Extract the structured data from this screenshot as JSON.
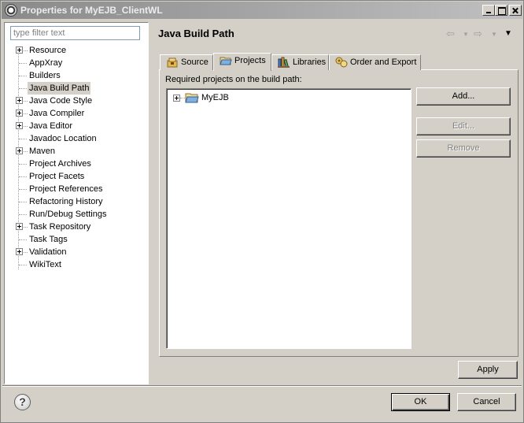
{
  "window": {
    "title": "Properties for MyEJB_ClientWL"
  },
  "filter": {
    "placeholder": "type filter text"
  },
  "tree": {
    "items": [
      {
        "label": "Resource",
        "expandable": true
      },
      {
        "label": "AppXray",
        "expandable": false
      },
      {
        "label": "Builders",
        "expandable": false
      },
      {
        "label": "Java Build Path",
        "expandable": false,
        "selected": true
      },
      {
        "label": "Java Code Style",
        "expandable": true
      },
      {
        "label": "Java Compiler",
        "expandable": true
      },
      {
        "label": "Java Editor",
        "expandable": true
      },
      {
        "label": "Javadoc Location",
        "expandable": false
      },
      {
        "label": "Maven",
        "expandable": true
      },
      {
        "label": "Project Archives",
        "expandable": false
      },
      {
        "label": "Project Facets",
        "expandable": false
      },
      {
        "label": "Project References",
        "expandable": false
      },
      {
        "label": "Refactoring History",
        "expandable": false
      },
      {
        "label": "Run/Debug Settings",
        "expandable": false
      },
      {
        "label": "Task Repository",
        "expandable": true
      },
      {
        "label": "Task Tags",
        "expandable": false
      },
      {
        "label": "Validation",
        "expandable": true
      },
      {
        "label": "WikiText",
        "expandable": false
      }
    ]
  },
  "page": {
    "title": "Java Build Path"
  },
  "tabs": [
    {
      "label": "Source",
      "icon": "source-icon"
    },
    {
      "label": "Projects",
      "icon": "folder-open-icon",
      "active": true
    },
    {
      "label": "Libraries",
      "icon": "libraries-icon"
    },
    {
      "label": "Order and Export",
      "icon": "order-export-icon"
    }
  ],
  "projects": {
    "caption": "Required projects on the build path:",
    "items": [
      {
        "label": "MyEJB"
      }
    ]
  },
  "buttons": {
    "add": "Add...",
    "edit": "Edit...",
    "remove": "Remove",
    "apply": "Apply",
    "ok": "OK",
    "cancel": "Cancel",
    "help": "?"
  }
}
